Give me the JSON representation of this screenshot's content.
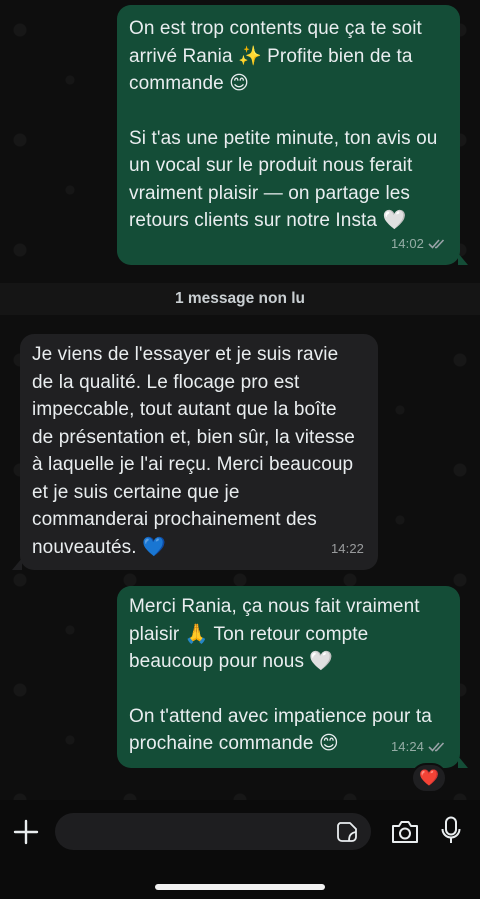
{
  "messages": [
    {
      "direction": "outgoing",
      "paragraphs": [
        "On est trop contents que ça te soit\narrivé Rania ✨ Profite bien de ta\ncommande 😊",
        "Si t'as une petite minute, ton avis ou\nun vocal sur le produit nous ferait\nvraiment plaisir — on partage les\nretours clients sur notre Insta 🤍"
      ],
      "time": "14:02",
      "status": "read"
    },
    {
      "direction": "incoming",
      "paragraphs": [
        "Je viens de l'essayer et je suis ravie\nde la qualité. Le flocage pro est\nimpeccable, tout autant que la boîte\nde présentation et, bien sûr, la vitesse\nà laquelle je l'ai reçu. Merci beaucoup\net je suis certaine que je\ncommanderai prochainement des\nnouveautés. 💙"
      ],
      "time": "14:22"
    },
    {
      "direction": "outgoing",
      "paragraphs": [
        "Merci Rania, ça nous fait vraiment\nplaisir 🙏 Ton retour compte\nbeaucoup pour nous 🤍",
        "On t'attend avec impatience pour ta\nprochaine commande 😊"
      ],
      "time": "14:24",
      "status": "read",
      "reaction": "❤️"
    }
  ],
  "unread_divider": "1 message non lu",
  "composer": {
    "placeholder": "",
    "icons": [
      "plus-icon",
      "sticker-icon",
      "camera-icon",
      "microphone-icon"
    ]
  },
  "colors": {
    "outgoing_bubble": "#144d37",
    "incoming_bubble": "#202022",
    "read_ticks": "#9aa3a8",
    "background": "#0e0e0e"
  }
}
